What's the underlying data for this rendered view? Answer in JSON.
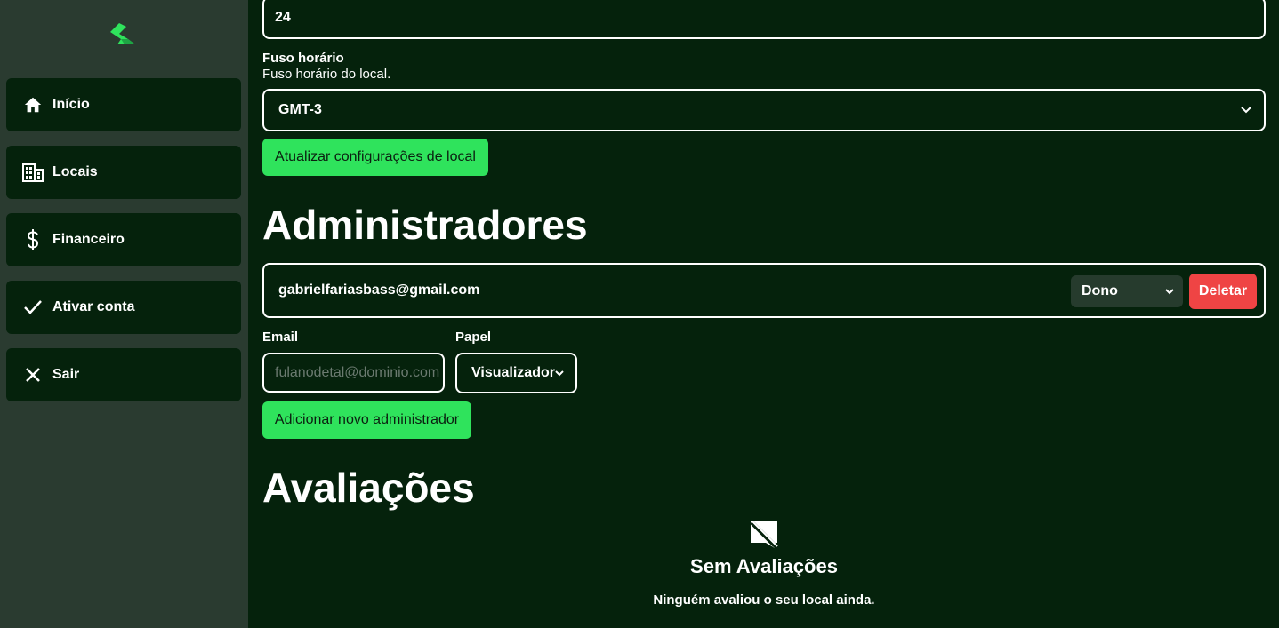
{
  "sidebar": {
    "logo": "brand-logo-icon",
    "items": [
      {
        "label": "Início",
        "icon": "home-icon"
      },
      {
        "label": "Locais",
        "icon": "building-icon"
      },
      {
        "label": "Financeiro",
        "icon": "dollar-icon"
      },
      {
        "label": "Ativar conta",
        "icon": "check-icon"
      },
      {
        "label": "Sair",
        "icon": "close-icon"
      }
    ]
  },
  "settings": {
    "field_value": "24",
    "timezone_label": "Fuso horário",
    "timezone_desc": "Fuso horário do local.",
    "timezone_value": "GMT-3",
    "update_button": "Atualizar configurações de local"
  },
  "admins": {
    "title": "Administradores",
    "list": [
      {
        "email": "gabrielfariasbass@gmail.com",
        "role": "Dono",
        "delete_label": "Deletar"
      }
    ],
    "email_label": "Email",
    "email_placeholder": "fulanodetal@dominio.com",
    "role_label": "Papel",
    "role_value": "Visualizador",
    "add_button": "Adicionar novo administrador"
  },
  "reviews": {
    "title": "Avaliações",
    "empty_title": "Sem Avaliações",
    "empty_desc": "Ninguém avaliou o seu local ainda."
  },
  "colors": {
    "background": "#05220c",
    "sidebar": "#2a3b30",
    "accent": "#2fe35c",
    "danger": "#ef4444"
  }
}
